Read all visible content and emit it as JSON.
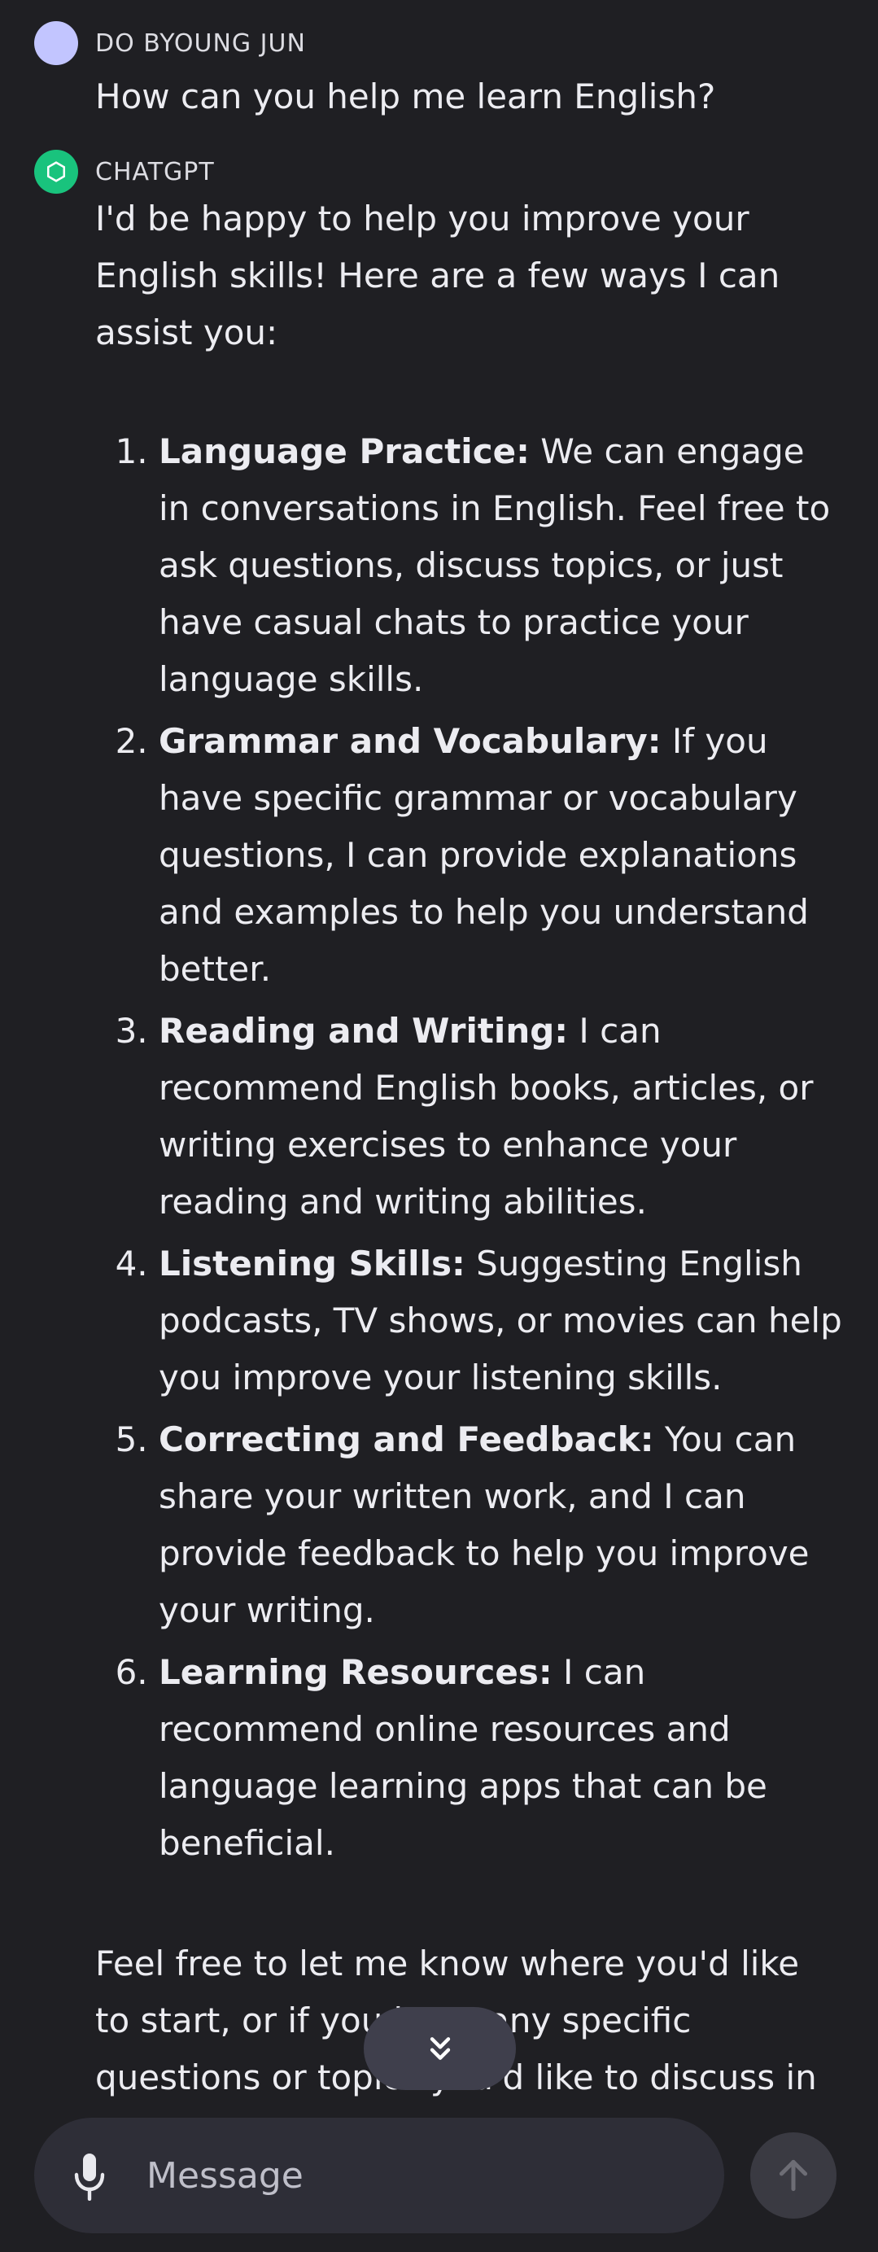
{
  "user_message": {
    "sender": "DO BYOUNG JUN",
    "text": "How can you help me learn English?",
    "avatar_color": "#c2c5ff"
  },
  "assistant_message": {
    "sender": "CHATGPT",
    "avatar_icon": "openai-logo-icon",
    "avatar_color": "#19c37d",
    "intro": "I'd be happy to help you improve your English skills! Here are a few ways I can assist you:",
    "items": [
      {
        "title": "Language Practice:",
        "text": " We can engage in conversations in English. Feel free to ask questions, discuss topics, or just have casual chats to practice your language skills."
      },
      {
        "title": "Grammar and Vocabulary:",
        "text": " If you have specific grammar or vocabulary questions, I can provide explanations and examples to help you understand better."
      },
      {
        "title": "Reading and Writing:",
        "text": " I can recommend English books, articles, or writing exercises to enhance your reading and writing abilities."
      },
      {
        "title": "Listening Skills:",
        "text": " Suggesting English podcasts, TV shows, or movies can help you improve your listening skills."
      },
      {
        "title": "Correcting and Feedback:",
        "text": " You can share your written work, and I can provide feedback to help you improve your writing."
      },
      {
        "title": "Learning Resources:",
        "text": " I can recommend online resources and language learning apps that can be beneficial."
      }
    ],
    "outro": "Feel free to let me know where you'd like to start, or if you have any specific questions or topics you'd like to discuss in English."
  },
  "scroll_button": {
    "icon": "double-chevron-down-icon"
  },
  "composer": {
    "placeholder": "Message",
    "mic_icon": "microphone-icon",
    "send_icon": "arrow-up-icon"
  },
  "colors": {
    "background": "#1f1f23",
    "composer_bg": "#2e2e37",
    "scroll_button_bg": "#3f3f4c",
    "send_button_bg": "#3a3a42",
    "text": "#ececf1"
  }
}
